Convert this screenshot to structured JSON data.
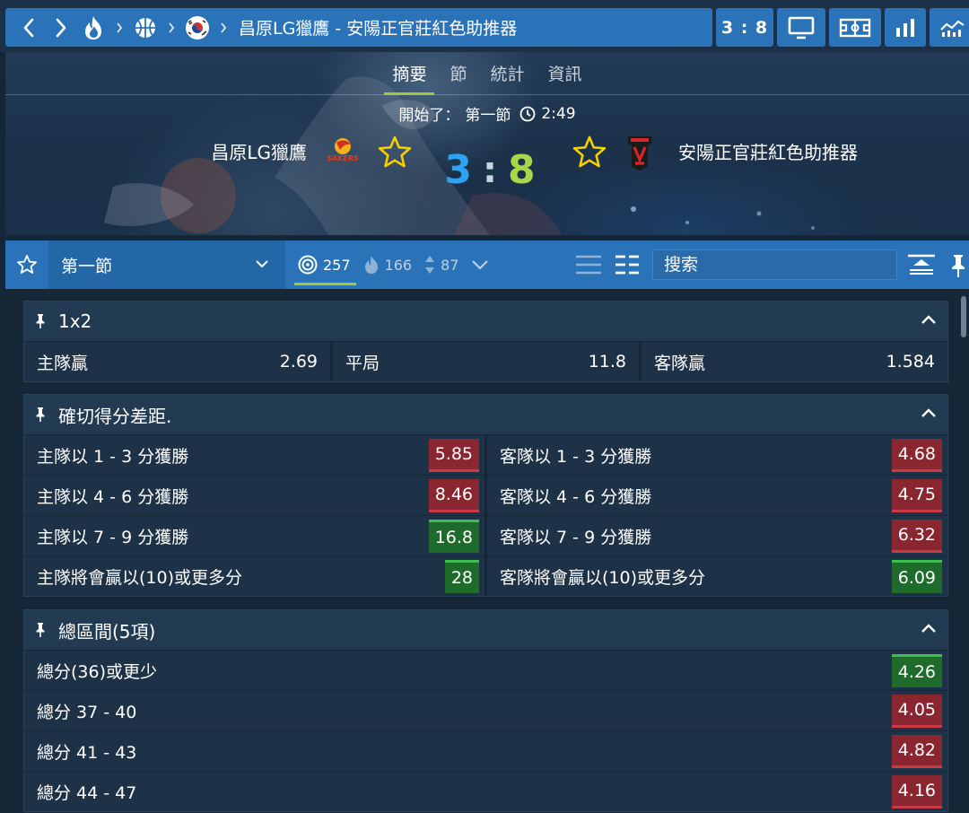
{
  "breadcrumb": {
    "title": "昌原LG獵鷹 - 安陽正官莊紅色助推器",
    "icons": [
      "chevron-left-icon",
      "chevron-right-icon",
      "fire-icon",
      "basketball-icon",
      "south-korea-flag-icon"
    ]
  },
  "topbar": {
    "score": "3 : 8",
    "tools": [
      "monitor-icon",
      "scoreboard-icon",
      "bar-chart-icon",
      "line-chart-icon"
    ]
  },
  "hero": {
    "tabs": [
      {
        "label": "摘要",
        "active": true
      },
      {
        "label": "節",
        "active": false
      },
      {
        "label": "統計",
        "active": false
      },
      {
        "label": "資訊",
        "active": false
      }
    ],
    "status_prefix": "開始了：",
    "period": "第一節",
    "clock": "2:49",
    "home_team": "昌原LG獵鷹",
    "away_team": "安陽正官莊紅色助推器",
    "home_logo_text": "SAKERS",
    "home_score": "3",
    "score_sep": ":",
    "away_score": "8"
  },
  "filterbar": {
    "period_select": "第一節",
    "counts": [
      {
        "icon": "target-icon",
        "value": "257",
        "active": true
      },
      {
        "icon": "fire-icon",
        "value": "166",
        "active": false
      },
      {
        "icon": "updown-arrows-icon",
        "value": "87",
        "active": false
      }
    ],
    "search_placeholder": "搜索"
  },
  "markets": {
    "m1x2": {
      "title": "1x2",
      "outcomes": [
        {
          "label": "主隊贏",
          "odd": "2.69"
        },
        {
          "label": "平局",
          "odd": "11.8"
        },
        {
          "label": "客隊贏",
          "odd": "1.584"
        }
      ]
    },
    "margin": {
      "title": "確切得分差距.",
      "rows": [
        {
          "home_label": "主隊以 1 - 3 分獲勝",
          "home_odd": "5.85",
          "home_trend": "down",
          "away_label": "客隊以 1 - 3 分獲勝",
          "away_odd": "4.68",
          "away_trend": "down"
        },
        {
          "home_label": "主隊以 4 - 6 分獲勝",
          "home_odd": "8.46",
          "home_trend": "down",
          "away_label": "客隊以 4 - 6 分獲勝",
          "away_odd": "4.75",
          "away_trend": "down"
        },
        {
          "home_label": "主隊以 7 - 9 分獲勝",
          "home_odd": "16.8",
          "home_trend": "up",
          "away_label": "客隊以 7 - 9 分獲勝",
          "away_odd": "6.32",
          "away_trend": "down"
        },
        {
          "home_label": "主隊將會贏以(10)或更多分",
          "home_odd": "28",
          "home_trend": "up",
          "away_label": "客隊將會贏以(10)或更多分",
          "away_odd": "6.09",
          "away_trend": "up"
        }
      ]
    },
    "totals": {
      "title": "總區間(5項)",
      "rows": [
        {
          "label": "總分(36)或更少",
          "odd": "4.26",
          "trend": "up"
        },
        {
          "label": "總分 37 - 40",
          "odd": "4.05",
          "trend": "down"
        },
        {
          "label": "總分 41 - 43",
          "odd": "4.82",
          "trend": "down"
        },
        {
          "label": "總分 44 - 47",
          "odd": "4.16",
          "trend": "down"
        }
      ]
    }
  },
  "colors": {
    "bar_blue": "#2a73b8",
    "accent_green": "#a4c639",
    "home_score": "#2ea3f2",
    "away_score": "#a8d84a",
    "star": "#f5d000",
    "odd_down": "#8a2630",
    "odd_up": "#1e6b2c"
  }
}
